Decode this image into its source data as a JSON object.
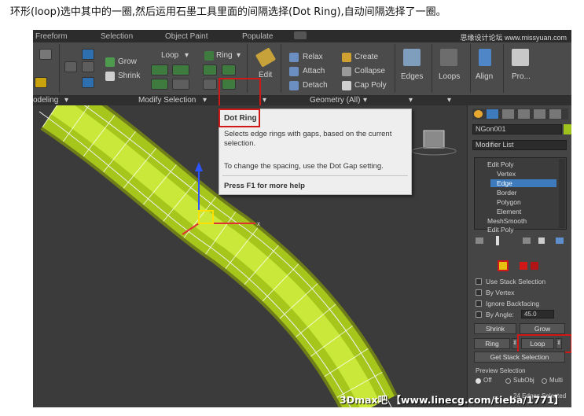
{
  "caption": "环形(loop)选中其中的一圈,然后运用石墨工具里面的间隔选择(Dot Ring),自动间隔选择了一圈。",
  "tabs": [
    "Freeform",
    "Selection",
    "Object Paint",
    "Populate"
  ],
  "watermark_top": "思缘设计论坛 www.missyuan.com",
  "ribbon": {
    "grow": "Grow",
    "shrink": "Shrink",
    "loop": "Loop",
    "ring": "Ring",
    "edit": "Edit",
    "relax": "Relax",
    "create": "Create",
    "attach": "Attach",
    "collapse": "Collapse",
    "detach": "Detach",
    "cap_poly": "Cap Poly",
    "edges": "Edges",
    "loops": "Loops",
    "align": "Align",
    "pro": "Pro..."
  },
  "panel_labels": {
    "modeling": "odeling",
    "modify_selection": "Modify Selection",
    "geometry_all": "Geometry (All)"
  },
  "tooltip": {
    "title": "Dot Ring",
    "desc": "Selects edge rings with gaps, based on the current selection.",
    "desc2": "To change the spacing, use the Dot Gap setting.",
    "help": "Press F1 for more help"
  },
  "footer_watermark": "3Dmax吧 【www.linecg.com/tieba/1771】",
  "modifier_panel": {
    "object_name": "NGon001",
    "modifier_list": "Modifier List",
    "stack": [
      "Edit Poly",
      "Vertex",
      "Edge",
      "Border",
      "Polygon",
      "Element",
      "MeshSmooth",
      "Edit Poly"
    ],
    "selected_item": "Edge",
    "options": [
      "Use Stack Selection",
      "By Vertex",
      "Ignore Backfacing",
      "By Angle:"
    ],
    "angle_value": "45.0",
    "shrink": "Shrink",
    "grow": "Grow",
    "ring": "Ring",
    "loop": "Loop",
    "get_stack_selection": "Get Stack Selection",
    "preview_selection": "Preview Selection",
    "preview_options": [
      "Off",
      "SubObj",
      "Multi"
    ],
    "status": "24 Edges Selected"
  },
  "colors": {
    "accent_red": "#d01818",
    "tube_green": "#b6d81e",
    "selection_blue": "#3d7bbd"
  }
}
